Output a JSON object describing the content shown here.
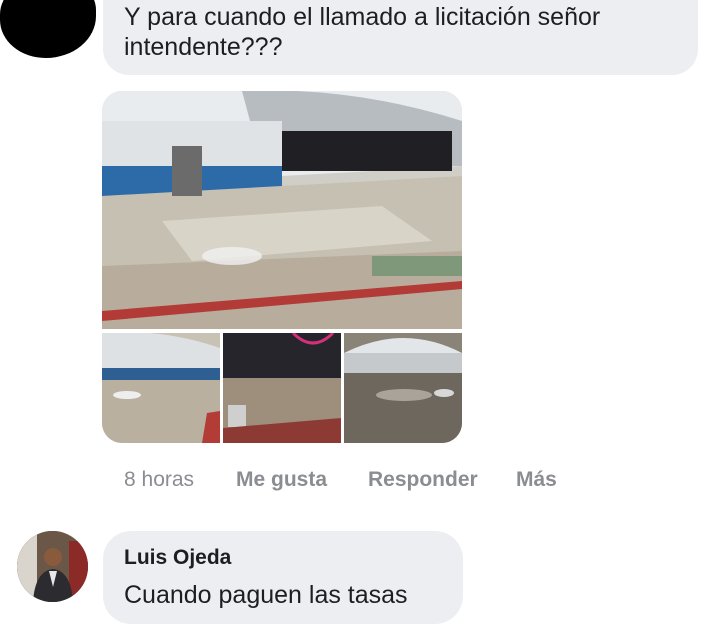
{
  "comment1": {
    "author_avatar": "redacted-avatar",
    "text": "Y para cuando el llamado a licitación señor intendente???",
    "photos": [
      {
        "name": "gym-floor-main-photo"
      },
      {
        "name": "gym-floor-photo-2"
      },
      {
        "name": "gym-floor-photo-3"
      },
      {
        "name": "gym-floor-photo-4"
      }
    ],
    "actions": {
      "time": "8 horas",
      "like": "Me gusta",
      "reply": "Responder",
      "more": "Más"
    }
  },
  "comment2": {
    "author": "Luis Ojeda",
    "text": "Cuando paguen las tasas"
  },
  "colors": {
    "bubble": "#eceef1",
    "action_text": "#8a8d91",
    "text": "#1c1e21"
  }
}
